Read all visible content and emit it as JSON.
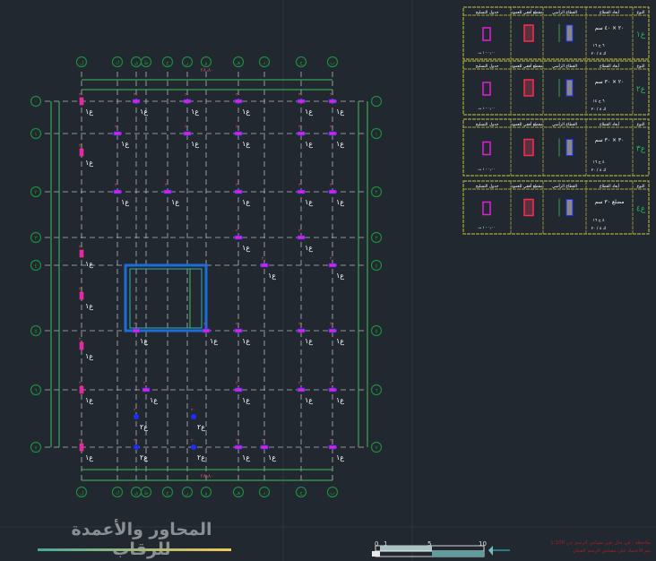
{
  "drawing": {
    "title": "المحاور والأعمدة للرقاب",
    "note_lines": [
      "ملاحظة : في حال تغير مقياس الرسم عن 1:100",
      "يتم الاعتماد على مقياس الرسم الفعلي"
    ],
    "scale_ticks": [
      "0",
      "1",
      "5",
      "10"
    ],
    "column_label": "ع١",
    "column_label_alt": "ع٢",
    "grid_cols": [
      "ل",
      "ك",
      "ي",
      "ط",
      "ح",
      "ز",
      "و",
      "هـ",
      "د",
      "ج",
      "ب",
      "أ"
    ],
    "grid_rows": [
      "٠",
      "١",
      "٢",
      "٣",
      "٤",
      "٥",
      "٦",
      "٧"
    ],
    "total_dim": "٢٨٫٨٠"
  },
  "schedule": {
    "headers": [
      "جدول التسليح",
      "مقطع أفقي للعمود",
      "القطاع الرأسي",
      "أبعاد القطاع",
      "النوع"
    ],
    "rows": [
      {
        "type": "ع١",
        "size": "٢٠ × ٤٠ سم",
        "bars": "٦ ح ١٦",
        "stirrups": "ك ٨ / ٢٠"
      },
      {
        "type": "ع٢",
        "size": "٢٠ × ٣٠ سم",
        "bars": "٦ ح ١٤",
        "stirrups": "ك ٨ / ٢٠"
      },
      {
        "type": "ع٣",
        "size": "٣٠ × ٣٠ سم",
        "bars": "٤ ح ١٦",
        "stirrups": "ك ٨ / ٢٠"
      },
      {
        "type": "ع٤",
        "size": "مضلع ٣٠ سم",
        "bars": "٤ ح ١٦",
        "stirrups": "ك ٨ / ٢٠"
      }
    ]
  },
  "colors": {
    "background": "#212830",
    "grid_line": "#b9b9b9",
    "axis_bubble": "#1f8a3c",
    "dimension": "#3fbf5a",
    "column": "#e01fd6",
    "column_blue": "#1f2bff",
    "annotation": "#c7486a",
    "table_border": "#a8a63a",
    "core_wall": "#1f6bd8"
  }
}
